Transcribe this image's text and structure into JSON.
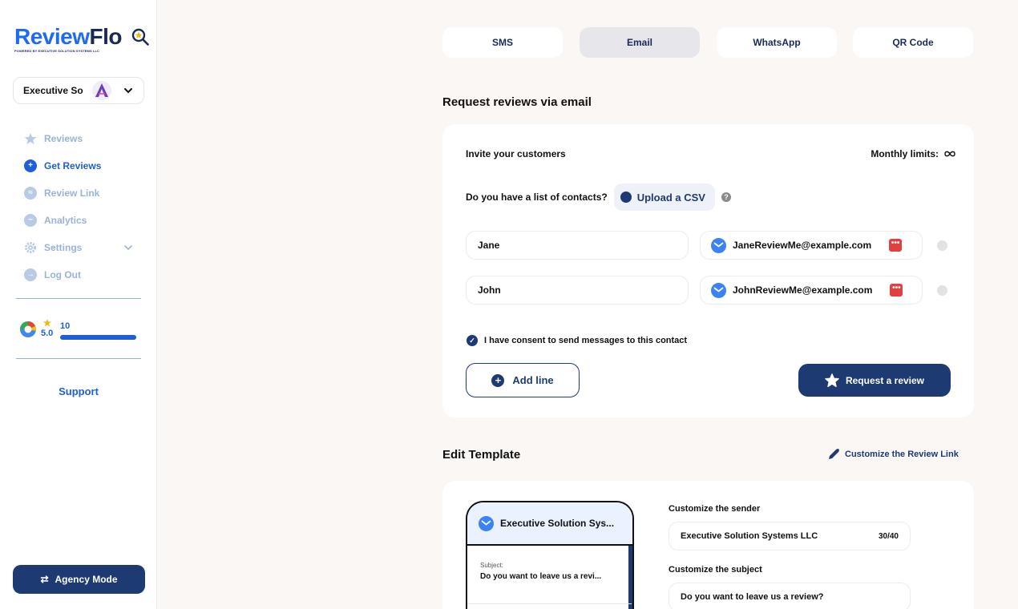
{
  "brand": {
    "name_part1": "Review",
    "name_part2": "Flo",
    "tagline": "POWERED BY EXECUTIVE SOLUTION SYSTEMS LLC"
  },
  "account": {
    "name": "Executive So"
  },
  "nav": {
    "items": [
      {
        "label": "Reviews",
        "icon": "star-icon"
      },
      {
        "label": "Get Reviews",
        "icon": "plus-icon",
        "active": true
      },
      {
        "label": "Review Link",
        "icon": "chat-icon"
      },
      {
        "label": "Analytics",
        "icon": "chart-icon"
      },
      {
        "label": "Settings",
        "icon": "gear-icon"
      },
      {
        "label": "Log Out",
        "icon": "logout-icon"
      }
    ]
  },
  "rating": {
    "score": "5.0",
    "count": "10",
    "progress": 1.0
  },
  "support_label": "Support",
  "agency_mode_label": "Agency Mode",
  "tabs": [
    {
      "label": "SMS"
    },
    {
      "label": "Email",
      "active": true
    },
    {
      "label": "WhatsApp"
    },
    {
      "label": "QR Code"
    }
  ],
  "request": {
    "title": "Request reviews via email",
    "invite_label": "Invite your customers",
    "monthly_limits_label": "Monthly limits:",
    "contacts_question": "Do you have a list of contacts?",
    "upload_csv_label": "Upload a CSV",
    "contacts": [
      {
        "name": "Jane",
        "email": "JaneReviewMe@example.com"
      },
      {
        "name": "John",
        "email": "JohnReviewMe@example.com"
      }
    ],
    "consent_label": "I have consent to send messages to this contact",
    "add_line_label": "Add line",
    "request_button_label": "Request a review"
  },
  "template": {
    "title": "Edit Template",
    "customize_link_label": "Customize the Review Link",
    "preview_sender": "Executive Solution Sys...",
    "preview_subject_label": "Subject:",
    "preview_subject": "Do you want to leave us a revi...",
    "sender_label": "Customize the sender",
    "sender_value": "Executive Solution Systems LLC",
    "sender_count": "30/40",
    "subject_label": "Customize the subject",
    "subject_value": "Do you want to leave us a review?"
  },
  "colors": {
    "primary": "#1e3a72",
    "accent": "#1e5fd8",
    "background": "#fbf7f4"
  }
}
